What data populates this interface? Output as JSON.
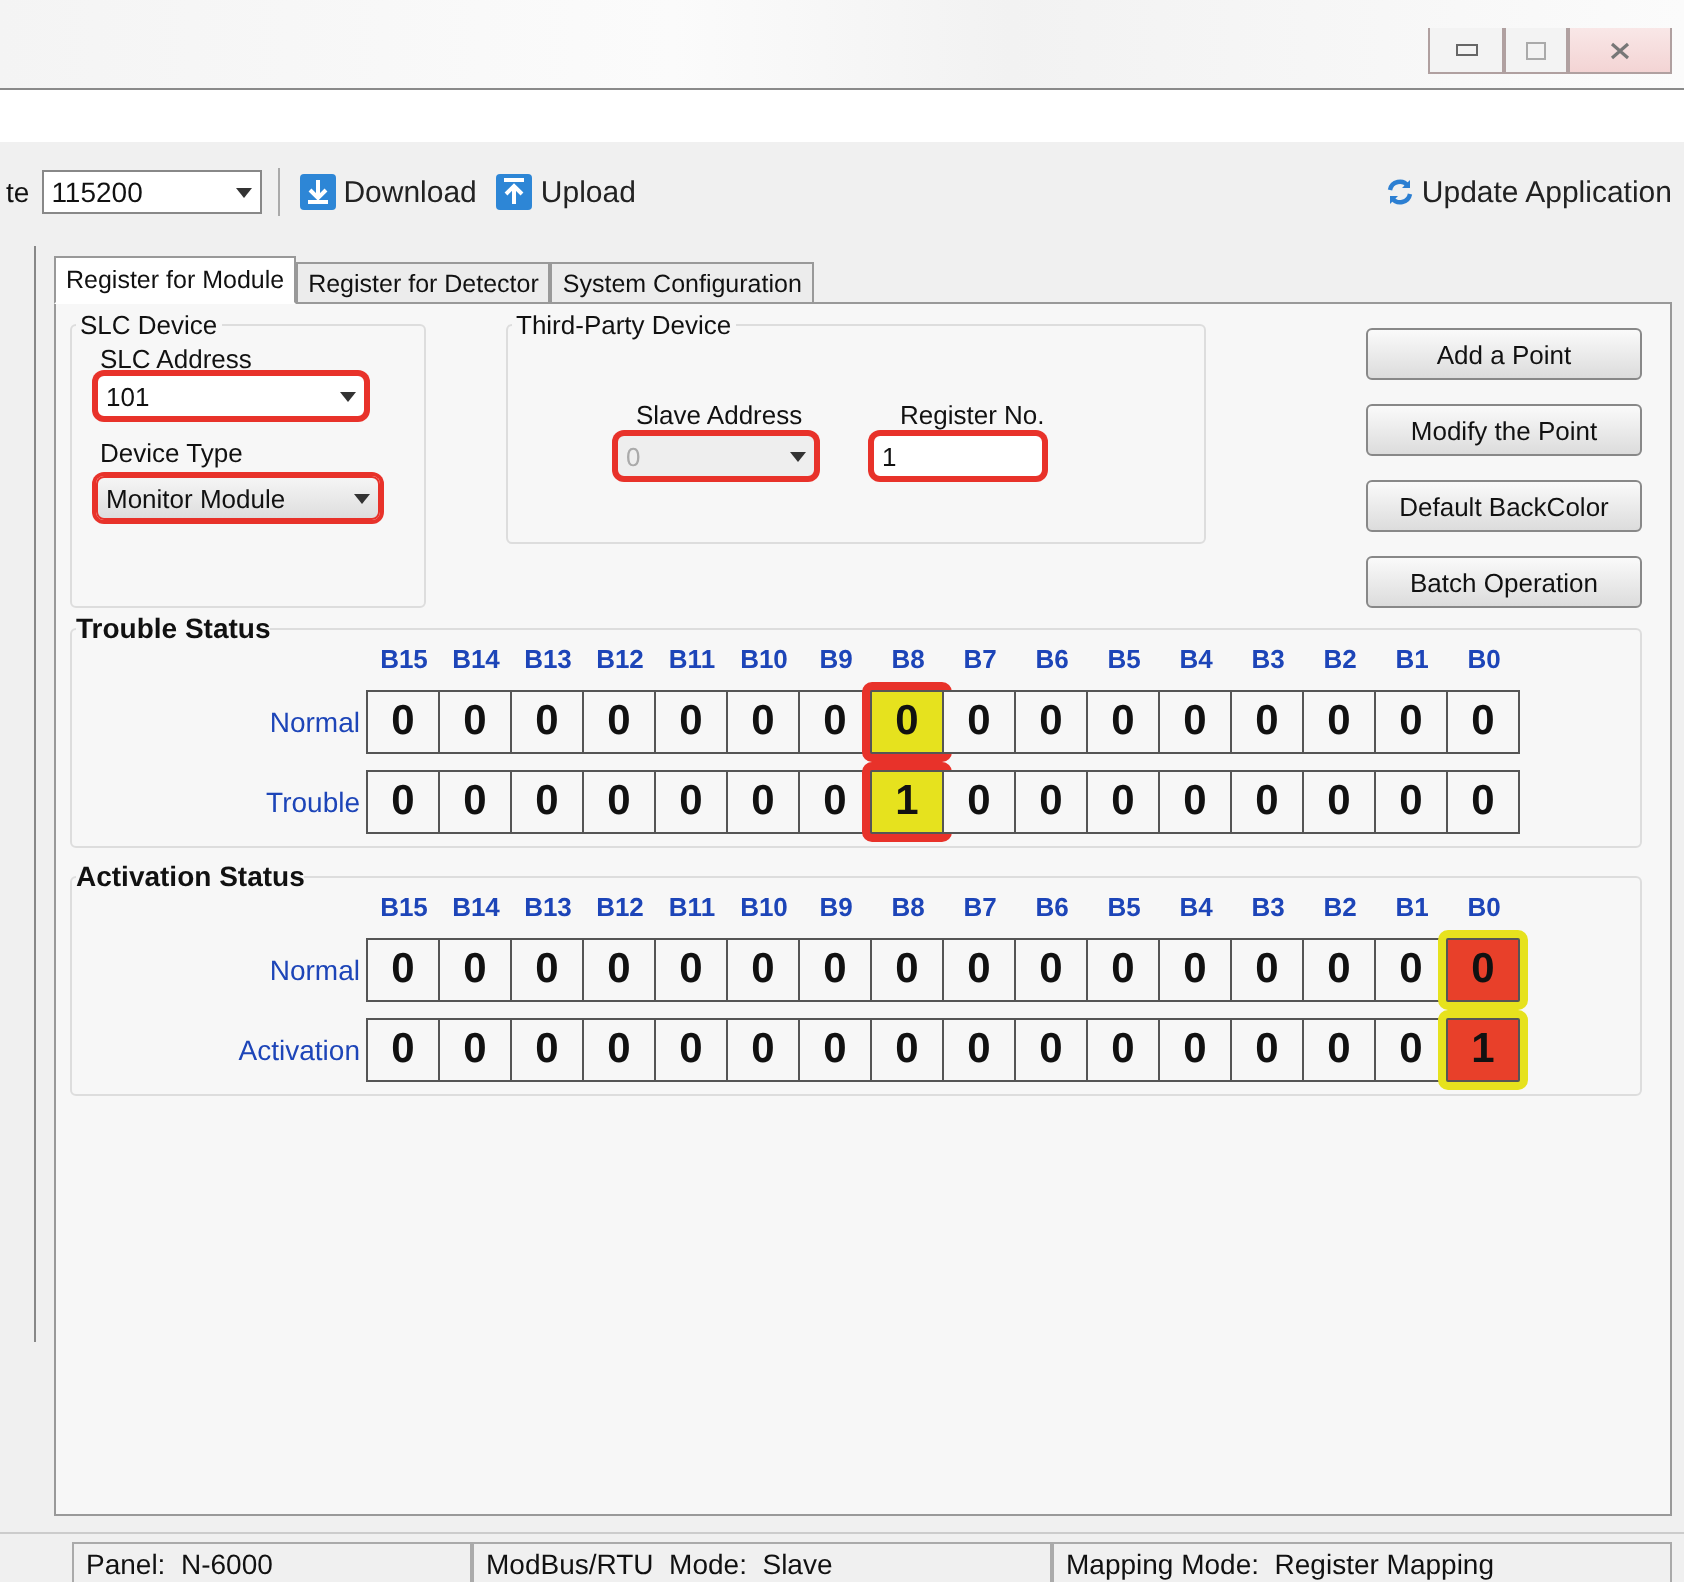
{
  "toolbar": {
    "cut_label": "te",
    "baud_rate": "115200",
    "download": "Download",
    "upload": "Upload",
    "update": "Update Application"
  },
  "tabs": [
    {
      "label": "Register for Module",
      "selected": true
    },
    {
      "label": "Register for Detector",
      "selected": false
    },
    {
      "label": "System Configuration",
      "selected": false
    }
  ],
  "slc_device": {
    "title": "SLC Device",
    "address_label": "SLC Address",
    "address": "101",
    "address_marked": true,
    "type_label": "Device Type",
    "type": "Monitor Module",
    "type_marked": true
  },
  "third_party": {
    "title": "Third-Party Device",
    "slave_label": "Slave Address",
    "slave": "0",
    "slave_disabled": true,
    "register_label": "Register No.",
    "register": "1",
    "marked": true
  },
  "buttons": [
    "Add a Point",
    "Modify the Point",
    "Default BackColor",
    "Batch Operation"
  ],
  "sections": [
    {
      "title": "Trouble Status",
      "headers": [
        "B15",
        "B14",
        "B13",
        "B12",
        "B11",
        "B10",
        "B9",
        "B8",
        "B7",
        "B6",
        "B5",
        "B4",
        "B3",
        "B2",
        "B1",
        "B0"
      ],
      "kind": "trouble",
      "rows": [
        {
          "label": "Normal",
          "cells": [
            {
              "v": "0",
              "highlighted": false
            },
            {
              "v": "0",
              "highlighted": false
            },
            {
              "v": "0",
              "highlighted": false
            },
            {
              "v": "0",
              "highlighted": false
            },
            {
              "v": "0",
              "highlighted": false
            },
            {
              "v": "0",
              "highlighted": false
            },
            {
              "v": "0",
              "highlighted": false
            },
            {
              "v": "0",
              "highlighted": true
            },
            {
              "v": "0",
              "highlighted": false
            },
            {
              "v": "0",
              "highlighted": false
            },
            {
              "v": "0",
              "highlighted": false
            },
            {
              "v": "0",
              "highlighted": false
            },
            {
              "v": "0",
              "highlighted": false
            },
            {
              "v": "0",
              "highlighted": false
            },
            {
              "v": "0",
              "highlighted": false
            },
            {
              "v": "0",
              "highlighted": false
            }
          ]
        },
        {
          "label": "Trouble",
          "cells": [
            {
              "v": "0",
              "highlighted": false
            },
            {
              "v": "0",
              "highlighted": false
            },
            {
              "v": "0",
              "highlighted": false
            },
            {
              "v": "0",
              "highlighted": false
            },
            {
              "v": "0",
              "highlighted": false
            },
            {
              "v": "0",
              "highlighted": false
            },
            {
              "v": "0",
              "highlighted": false
            },
            {
              "v": "1",
              "highlighted": true
            },
            {
              "v": "0",
              "highlighted": false
            },
            {
              "v": "0",
              "highlighted": false
            },
            {
              "v": "0",
              "highlighted": false
            },
            {
              "v": "0",
              "highlighted": false
            },
            {
              "v": "0",
              "highlighted": false
            },
            {
              "v": "0",
              "highlighted": false
            },
            {
              "v": "0",
              "highlighted": false
            },
            {
              "v": "0",
              "highlighted": false
            }
          ]
        }
      ]
    },
    {
      "title": "Activation Status",
      "headers": [
        "B15",
        "B14",
        "B13",
        "B12",
        "B11",
        "B10",
        "B9",
        "B8",
        "B7",
        "B6",
        "B5",
        "B4",
        "B3",
        "B2",
        "B1",
        "B0"
      ],
      "kind": "activation",
      "rows": [
        {
          "label": "Normal",
          "cells": [
            {
              "v": "0",
              "highlighted": false
            },
            {
              "v": "0",
              "highlighted": false
            },
            {
              "v": "0",
              "highlighted": false
            },
            {
              "v": "0",
              "highlighted": false
            },
            {
              "v": "0",
              "highlighted": false
            },
            {
              "v": "0",
              "highlighted": false
            },
            {
              "v": "0",
              "highlighted": false
            },
            {
              "v": "0",
              "highlighted": false
            },
            {
              "v": "0",
              "highlighted": false
            },
            {
              "v": "0",
              "highlighted": false
            },
            {
              "v": "0",
              "highlighted": false
            },
            {
              "v": "0",
              "highlighted": false
            },
            {
              "v": "0",
              "highlighted": false
            },
            {
              "v": "0",
              "highlighted": false
            },
            {
              "v": "0",
              "highlighted": false
            },
            {
              "v": "0",
              "highlighted": true
            }
          ]
        },
        {
          "label": "Activation",
          "cells": [
            {
              "v": "0",
              "highlighted": false
            },
            {
              "v": "0",
              "highlighted": false
            },
            {
              "v": "0",
              "highlighted": false
            },
            {
              "v": "0",
              "highlighted": false
            },
            {
              "v": "0",
              "highlighted": false
            },
            {
              "v": "0",
              "highlighted": false
            },
            {
              "v": "0",
              "highlighted": false
            },
            {
              "v": "0",
              "highlighted": false
            },
            {
              "v": "0",
              "highlighted": false
            },
            {
              "v": "0",
              "highlighted": false
            },
            {
              "v": "0",
              "highlighted": false
            },
            {
              "v": "0",
              "highlighted": false
            },
            {
              "v": "0",
              "highlighted": false
            },
            {
              "v": "0",
              "highlighted": false
            },
            {
              "v": "0",
              "highlighted": false
            },
            {
              "v": "1",
              "highlighted": true
            }
          ]
        }
      ]
    }
  ],
  "status_bar": [
    {
      "label": "Panel:",
      "value": "N-6000"
    },
    {
      "label": "ModBus/RTU  Mode:",
      "value": "Slave"
    },
    {
      "label": "Mapping Mode:",
      "value": "Register Mapping"
    }
  ]
}
